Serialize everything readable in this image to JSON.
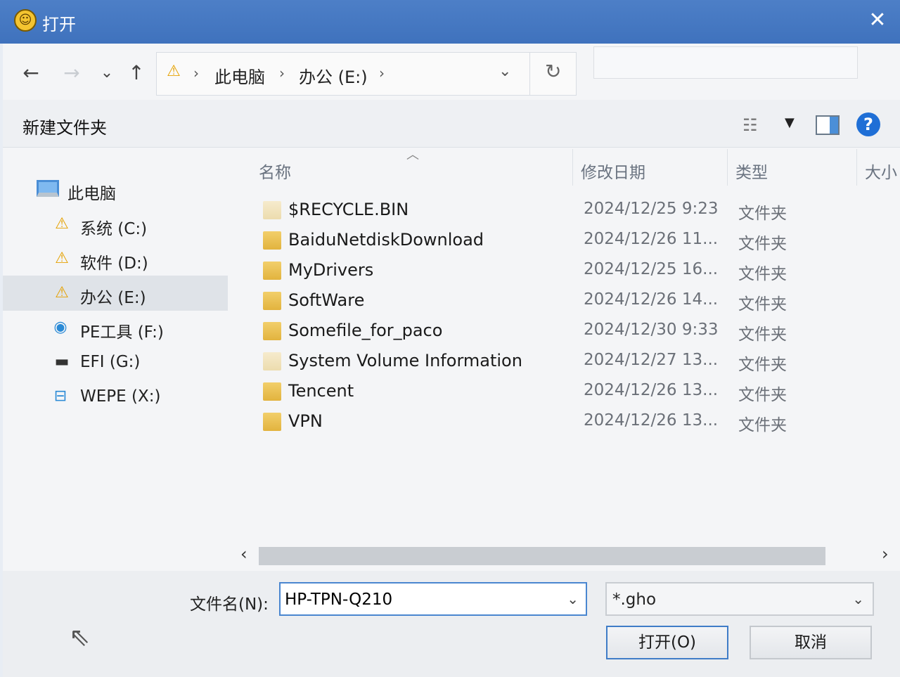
{
  "window": {
    "title": "打开",
    "app_icon": "lion-app-icon",
    "close_glyph": "✕"
  },
  "nav": {
    "back": "←",
    "forward": "→",
    "recent": "⌄",
    "up": "↑"
  },
  "address": {
    "breadcrumbs": [
      "此电脑",
      "办公 (E:)"
    ],
    "separator": "›",
    "dropdown": "⌄",
    "refresh": "↻"
  },
  "toolbar": {
    "new_folder": "新建文件夹",
    "help": "?"
  },
  "sidebar": {
    "items": [
      {
        "label": "此电脑",
        "icon": "computer-icon"
      },
      {
        "label": "系统 (C:)",
        "icon": "drive-warning-icon"
      },
      {
        "label": "软件 (D:)",
        "icon": "drive-warning-icon"
      },
      {
        "label": "办公 (E:)",
        "icon": "drive-warning-icon",
        "selected": true
      },
      {
        "label": "PE工具 (F:)",
        "icon": "cd-drive-icon"
      },
      {
        "label": "EFI (G:)",
        "icon": "disk-drive-icon"
      },
      {
        "label": "WEPE (X:)",
        "icon": "network-drive-icon"
      }
    ]
  },
  "columns": {
    "name": "名称",
    "date": "修改日期",
    "type": "类型",
    "size": "大小"
  },
  "files": [
    {
      "name": "$RECYCLE.BIN",
      "date": "2024/12/25 9:23",
      "type": "文件夹",
      "faded": true
    },
    {
      "name": "BaiduNetdiskDownload",
      "date": "2024/12/26 11...",
      "type": "文件夹"
    },
    {
      "name": "MyDrivers",
      "date": "2024/12/25 16...",
      "type": "文件夹"
    },
    {
      "name": "SoftWare",
      "date": "2024/12/26 14...",
      "type": "文件夹"
    },
    {
      "name": "Somefile_for_paco",
      "date": "2024/12/30 9:33",
      "type": "文件夹"
    },
    {
      "name": "System Volume Information",
      "date": "2024/12/27 13...",
      "type": "文件夹",
      "faded": true
    },
    {
      "name": "Tencent",
      "date": "2024/12/26 13...",
      "type": "文件夹"
    },
    {
      "name": "VPN",
      "date": "2024/12/26 13...",
      "type": "文件夹"
    }
  ],
  "scroll": {
    "left": "‹",
    "right": "›"
  },
  "bottom": {
    "filename_label": "文件名(N):",
    "filename_value": "HP-TPN-Q210",
    "filter_value": "*.gho",
    "dropdown": "⌄",
    "open_label": "打开(O)",
    "cancel_label": "取消"
  },
  "colors": {
    "titlebar": "#4177c2",
    "accent": "#3f7cc7",
    "folder": "#e8bf4f"
  }
}
